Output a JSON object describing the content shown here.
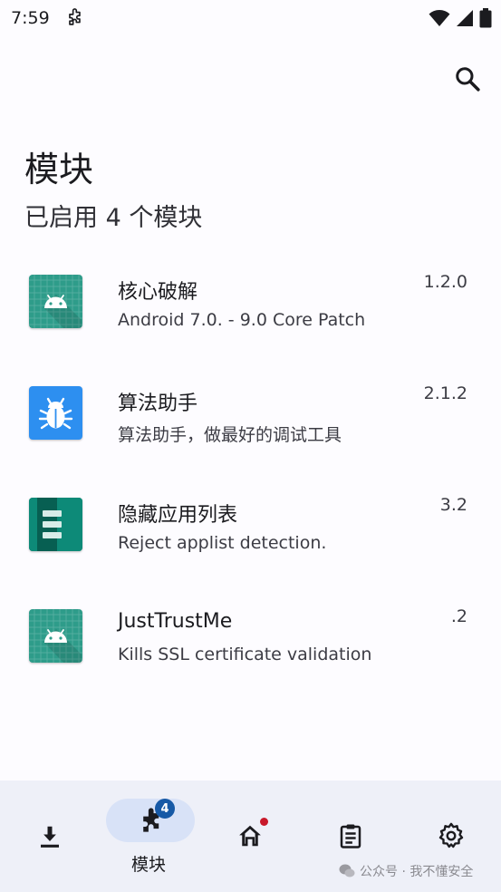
{
  "status_bar": {
    "time": "7:59"
  },
  "header": {
    "title": "模块",
    "subtitle": "已启用 4 个模块"
  },
  "modules": [
    {
      "name": "核心破解",
      "description": "Android 7.0. - 9.0 Core Patch",
      "version": "1.2.0",
      "icon": "android-icon",
      "color": "#2e9c8a"
    },
    {
      "name": "算法助手",
      "description": "算法助手，做最好的调试工具",
      "version": "2.1.2",
      "icon": "bug-icon",
      "color": "#2d8ff0"
    },
    {
      "name": "隐藏应用列表",
      "description": "Reject applist detection.",
      "version": "3.2",
      "icon": "list-icon",
      "color": "#0d8a78"
    },
    {
      "name": "JustTrustMe",
      "description": "Kills SSL certificate validation",
      "version": ".2",
      "icon": "android-icon",
      "color": "#2e9c8a"
    }
  ],
  "bottom_nav": {
    "active_label": "模块",
    "badge_count": "4",
    "items": [
      "download-icon",
      "puzzle-icon",
      "home-icon",
      "log-icon",
      "settings-icon"
    ]
  },
  "watermark": "公众号 · 我不懂安全"
}
